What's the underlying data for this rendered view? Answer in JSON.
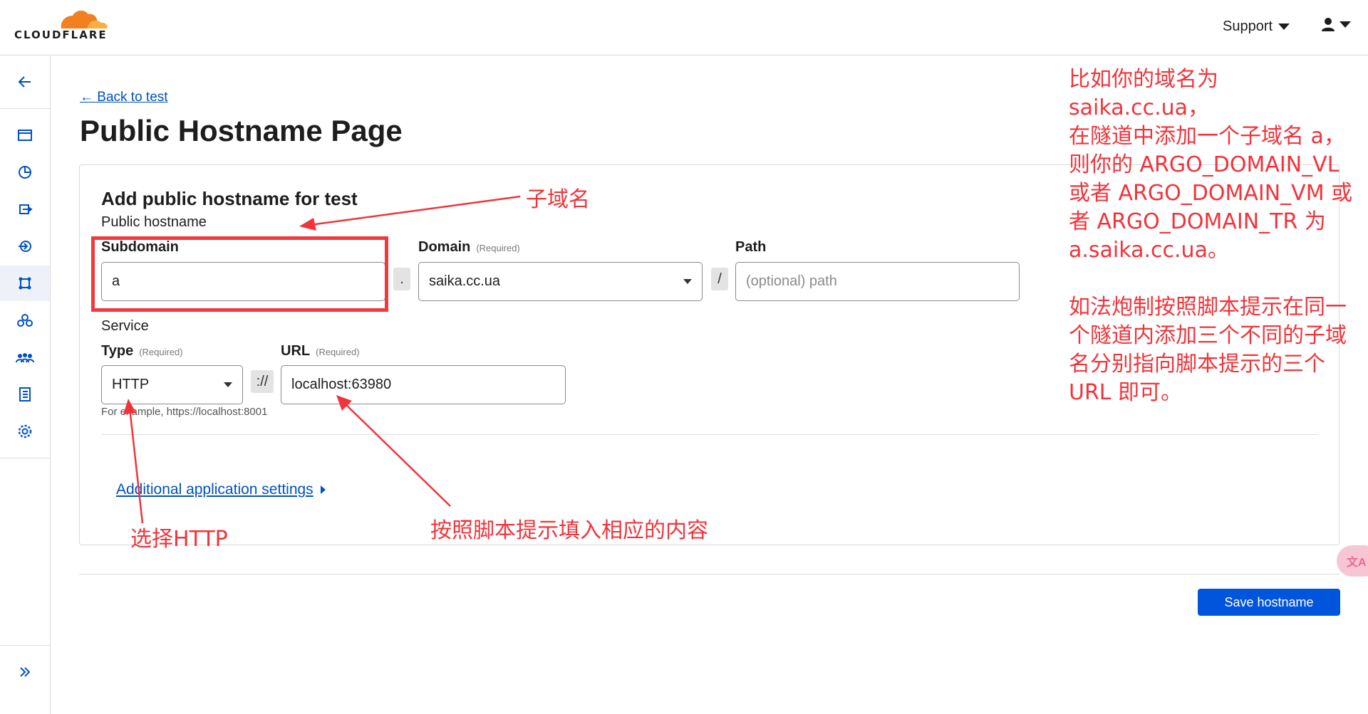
{
  "header": {
    "logo_text": "CLOUDFLARE",
    "support_label": "Support"
  },
  "colors": {
    "accent": "#0051c3",
    "brand_orange": "#f38020",
    "annotation_red": "#f2333a",
    "primary_button": "#0055dc"
  },
  "sidebar": {
    "items": [
      {
        "icon": "back-arrow-icon"
      },
      {
        "icon": "browser-window-icon"
      },
      {
        "icon": "analytics-pie-icon"
      },
      {
        "icon": "gateway-icon"
      },
      {
        "icon": "access-icon"
      },
      {
        "icon": "networks-icon"
      },
      {
        "icon": "cloud-tunnel-icon"
      },
      {
        "icon": "team-icon"
      },
      {
        "icon": "logs-icon"
      },
      {
        "icon": "settings-gear-icon"
      }
    ],
    "collapse_icon": "expand-chevrons-icon"
  },
  "page": {
    "back_link": "← Back to test",
    "title": "Public Hostname Page"
  },
  "card": {
    "title": "Add public hostname for test",
    "public_hostname_label": "Public hostname",
    "subdomain": {
      "label": "Subdomain",
      "value": "a"
    },
    "dot_separator": ".",
    "domain": {
      "label": "Domain",
      "required": "(Required)",
      "value": "saika.cc.ua"
    },
    "slash_separator": "/",
    "path": {
      "label": "Path",
      "placeholder": "(optional) path"
    },
    "service_label": "Service",
    "type": {
      "label": "Type",
      "required": "(Required)",
      "value": "HTTP"
    },
    "scheme_separator": "://",
    "url": {
      "label": "URL",
      "required": "(Required)",
      "value": "localhost:63980"
    },
    "help_text": "For example, https://localhost:8001",
    "additional_settings": "Additional application settings"
  },
  "actions": {
    "save_label": "Save hostname"
  },
  "annotations": {
    "subdomain_note": "子域名",
    "http_note": "选择HTTP",
    "url_note": "按照脚本提示填入相应的内容",
    "side_note_lines": [
      "比如你的域名为 saika.cc.ua，",
      "在隧道中添加一个子域名 a，",
      "则你的 ARGO_DOMAIN_VL",
      "或者 ARGO_DOMAIN_VM 或",
      "者 ARGO_DOMAIN_TR 为",
      "a.saika.cc.ua。"
    ],
    "side_note_lines_2": [
      "如法炮制按照脚本提示在同一",
      "个隧道内添加三个不同的子域",
      "名分别指向脚本提示的三个",
      "URL 即可。"
    ]
  },
  "translate_button": "文A"
}
